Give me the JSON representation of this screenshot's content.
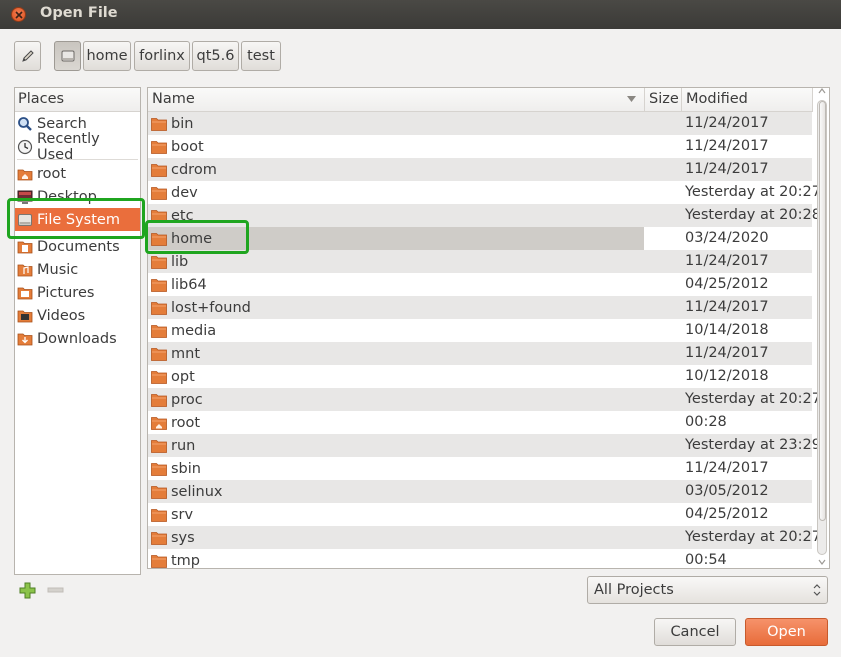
{
  "window": {
    "title": "Open File"
  },
  "pathbar": {
    "segments": [
      "home",
      "forlinx",
      "qt5.6",
      "test"
    ]
  },
  "places": {
    "header": "Places",
    "items": [
      {
        "label": "Search",
        "icon": "search-icon"
      },
      {
        "label": "Recently Used",
        "icon": "clock-icon"
      },
      {
        "label": "root",
        "icon": "home-folder-icon"
      },
      {
        "label": "Desktop",
        "icon": "desktop-icon"
      },
      {
        "label": "File System",
        "icon": "drive-icon",
        "selected": true
      },
      {
        "label": "Documents",
        "icon": "documents-icon"
      },
      {
        "label": "Music",
        "icon": "music-icon"
      },
      {
        "label": "Pictures",
        "icon": "pictures-icon"
      },
      {
        "label": "Videos",
        "icon": "videos-icon"
      },
      {
        "label": "Downloads",
        "icon": "downloads-icon"
      }
    ]
  },
  "filelist": {
    "columns": {
      "name": "Name",
      "size": "Size",
      "modified": "Modified"
    },
    "rows": [
      {
        "name": "bin",
        "size": "",
        "modified": "11/24/2017"
      },
      {
        "name": "boot",
        "size": "",
        "modified": "11/24/2017"
      },
      {
        "name": "cdrom",
        "size": "",
        "modified": "11/24/2017"
      },
      {
        "name": "dev",
        "size": "",
        "modified": "Yesterday at 20:27"
      },
      {
        "name": "etc",
        "size": "",
        "modified": "Yesterday at 20:28"
      },
      {
        "name": "home",
        "size": "",
        "modified": "03/24/2020"
      },
      {
        "name": "lib",
        "size": "",
        "modified": "11/24/2017"
      },
      {
        "name": "lib64",
        "size": "",
        "modified": "04/25/2012"
      },
      {
        "name": "lost+found",
        "size": "",
        "modified": "11/24/2017"
      },
      {
        "name": "media",
        "size": "",
        "modified": "10/14/2018"
      },
      {
        "name": "mnt",
        "size": "",
        "modified": "11/24/2017"
      },
      {
        "name": "opt",
        "size": "",
        "modified": "10/12/2018"
      },
      {
        "name": "proc",
        "size": "",
        "modified": "Yesterday at 20:27"
      },
      {
        "name": "root",
        "size": "",
        "modified": "00:28"
      },
      {
        "name": "run",
        "size": "",
        "modified": "Yesterday at 23:29"
      },
      {
        "name": "sbin",
        "size": "",
        "modified": "11/24/2017"
      },
      {
        "name": "selinux",
        "size": "",
        "modified": "03/05/2012"
      },
      {
        "name": "srv",
        "size": "",
        "modified": "04/25/2012"
      },
      {
        "name": "sys",
        "size": "",
        "modified": "Yesterday at 20:27"
      },
      {
        "name": "tmp",
        "size": "",
        "modified": "00:54"
      }
    ]
  },
  "filter": {
    "selected": "All Projects"
  },
  "buttons": {
    "cancel": "Cancel",
    "open": "Open"
  },
  "colors": {
    "accent": "#ea6e3c",
    "highlight": "#1fa51f",
    "folder": "#e47d3a"
  }
}
